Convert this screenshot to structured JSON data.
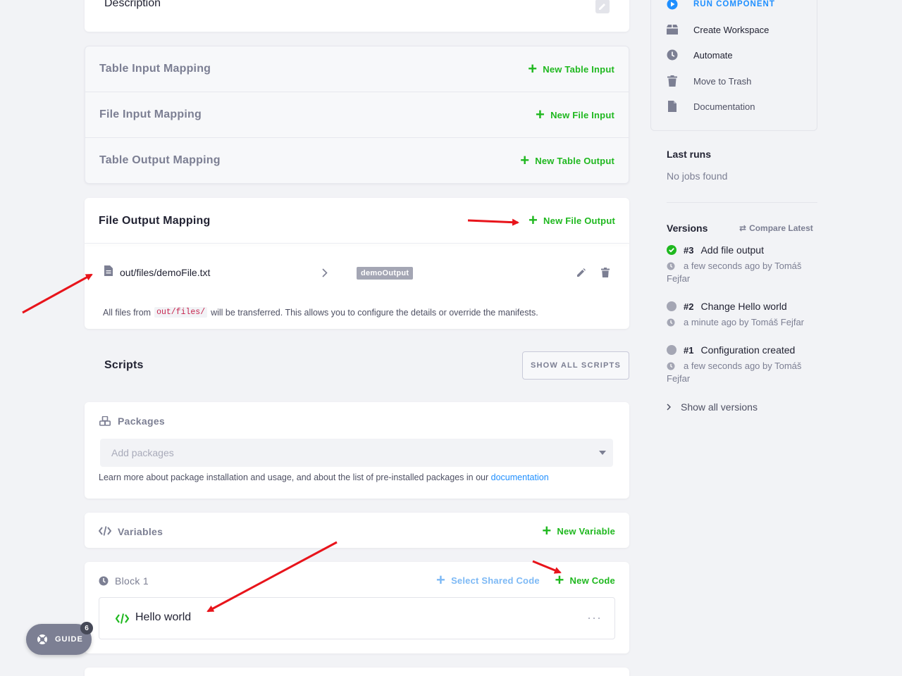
{
  "description": {
    "title": "Description"
  },
  "mappings": {
    "table_input": {
      "title": "Table Input Mapping",
      "action": "New Table Input"
    },
    "file_input": {
      "title": "File Input Mapping",
      "action": "New File Input"
    },
    "table_output": {
      "title": "Table Output Mapping",
      "action": "New Table Output"
    }
  },
  "file_output": {
    "title": "File Output Mapping",
    "action": "New File Output",
    "row": {
      "source": "out/files/demoFile.txt",
      "tag": "demoOutput"
    },
    "note_pre": "All files from",
    "note_code": "out/files/",
    "note_post": "will be transferred. This allows you to configure the details or override the manifests."
  },
  "scripts": {
    "title": "Scripts",
    "show_all": "SHOW ALL SCRIPTS"
  },
  "packages": {
    "title": "Packages",
    "placeholder": "Add packages",
    "help_pre": "Learn more about package installation and usage, and about the list of pre-installed packages in our",
    "help_link": "documentation"
  },
  "variables": {
    "title": "Variables",
    "action": "New Variable"
  },
  "block": {
    "title": "Block 1",
    "shared": "Select Shared Code",
    "new_code": "New Code",
    "code_name": "Hello world"
  },
  "guide": {
    "label": "GUIDE",
    "count": "6"
  },
  "sidebar": {
    "actions": [
      {
        "label": "RUN COMPONENT",
        "icon": "play-circle-icon"
      },
      {
        "label": "Create Workspace",
        "icon": "workspace-icon"
      },
      {
        "label": "Automate",
        "icon": "clock-icon"
      },
      {
        "label": "Move to Trash",
        "icon": "trash-icon"
      },
      {
        "label": "Documentation",
        "icon": "document-icon"
      }
    ],
    "last_runs": {
      "title": "Last runs",
      "empty": "No jobs found"
    },
    "versions": {
      "title": "Versions",
      "compare": "Compare Latest",
      "items": [
        {
          "num": "#3",
          "name": "Add file output",
          "meta": "a few seconds ago by Tomáš",
          "meta2": "Fejfar",
          "status": "success"
        },
        {
          "num": "#2",
          "name": "Change Hello world",
          "meta": "a minute ago by Tomáš Fejfar",
          "meta2": "",
          "status": "neutral"
        },
        {
          "num": "#1",
          "name": "Configuration created",
          "meta": "a few seconds ago by Tomáš",
          "meta2": "Fejfar",
          "status": "neutral"
        }
      ],
      "show_all": "Show all versions"
    }
  },
  "colors": {
    "accent_green": "#1fb81f",
    "accent_blue": "#1f8fff",
    "annotation_red": "#e8141b",
    "muted": "#7c7f93"
  }
}
